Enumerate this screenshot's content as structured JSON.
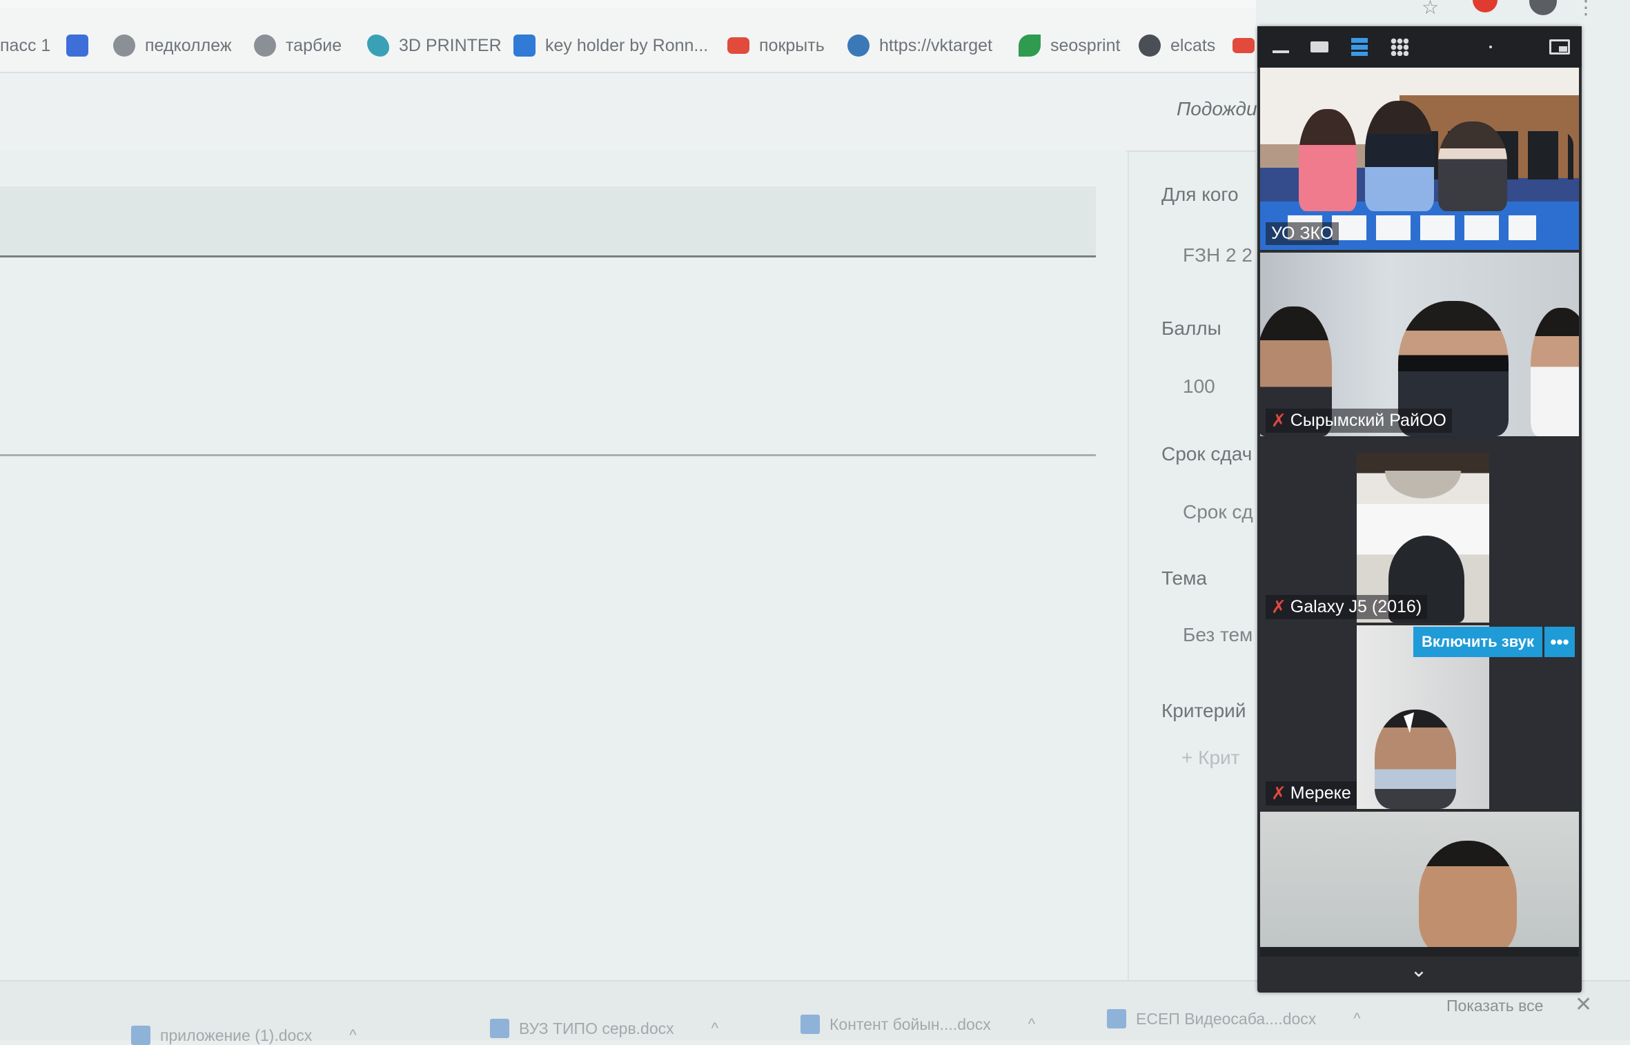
{
  "browser": {
    "top_url_fragment": "",
    "bookmarks": [
      {
        "label": "пасс 1",
        "icon": "none"
      },
      {
        "label": "",
        "icon": "doc-icon"
      },
      {
        "label": "педколлеж",
        "icon": "grey"
      },
      {
        "label": "тарбие",
        "icon": "grey"
      },
      {
        "label": "3D PRINTER",
        "icon": "teal"
      },
      {
        "label": "key holder by Ronn...",
        "icon": "blue"
      },
      {
        "label": "покрыть",
        "icon": "red"
      },
      {
        "label": "https://vktarget",
        "icon": "globe"
      },
      {
        "label": "seosprint",
        "icon": "green"
      },
      {
        "label": "elcats",
        "icon": "dark"
      }
    ]
  },
  "page": {
    "save_status": "Подожди",
    "right_panel": {
      "for_whom_label": "Для кого",
      "for_whom_value": "FЗН 2 2",
      "points_label": "Баллы",
      "points_value": "100",
      "due_label": "Срок сдач",
      "due_value": "Срок сд",
      "topic_label": "Тема",
      "topic_value": "Без тем",
      "criteria_label": "Критерий",
      "criteria_add": "+ Крит"
    }
  },
  "call": {
    "participants": [
      {
        "name": "УО ЗКО",
        "muted": false
      },
      {
        "name": "Сырымский РайОО",
        "muted": true
      },
      {
        "name": "Galaxy J5 (2016)",
        "muted": true
      },
      {
        "name": "Мереке",
        "muted": true
      },
      {
        "name": "",
        "muted": false
      }
    ],
    "unmute_label": "Включить звук",
    "more_label": "•••",
    "collapse_icon": "⌄"
  },
  "downloads": {
    "items": [
      {
        "label": "приложение (1).docx"
      },
      {
        "label": "ВУЗ ТИПО серв.docx"
      },
      {
        "label": "Контент бойын....docx"
      },
      {
        "label": "ЕСЕП Видеосаба....docx"
      }
    ],
    "show_all": "Показать все",
    "close": "✕"
  }
}
